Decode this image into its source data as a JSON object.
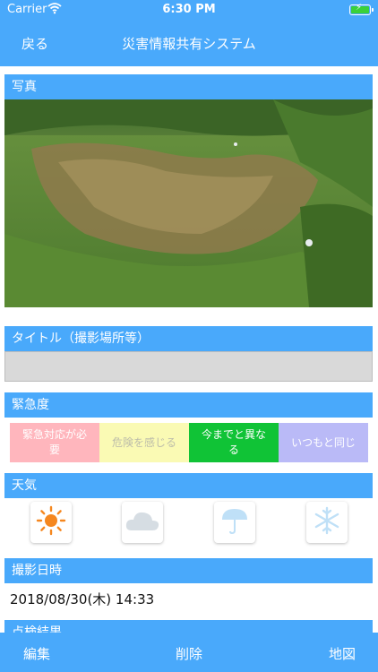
{
  "status_bar": {
    "carrier": "Carrier",
    "time": "6:30 PM",
    "wifi_icon": "wifi-icon",
    "battery_icon": "battery-charging-icon"
  },
  "nav": {
    "back_label": "戻る",
    "title": "災害情報共有システム"
  },
  "sections": {
    "photo": "写真",
    "title_field": "タイトル（撮影場所等）",
    "urgency": "緊急度",
    "weather": "天気",
    "datetime": "撮影日時",
    "inspection": "点検結果"
  },
  "title_field_value": "",
  "urgency_options": [
    {
      "label": "緊急対応が必要",
      "color": "#ffb6bd"
    },
    {
      "label": "危険を感じる",
      "color": "#fafab4"
    },
    {
      "label": "今までと異なる",
      "color": "#10c336"
    },
    {
      "label": "いつもと同じ",
      "color": "#babaf7"
    }
  ],
  "weather_options": [
    {
      "icon": "sun-icon",
      "selected": true
    },
    {
      "icon": "cloud-icon",
      "selected": false
    },
    {
      "icon": "umbrella-icon",
      "selected": false
    },
    {
      "icon": "snowflake-icon",
      "selected": false
    }
  ],
  "datetime_value": "2018/08/30(木) 14:33",
  "tabbar": {
    "edit": "編集",
    "delete": "削除",
    "map": "地図"
  },
  "colors": {
    "accent": "#49a9fb",
    "sun": "#f5871f",
    "inactive_icon": "#bfe0f7"
  }
}
